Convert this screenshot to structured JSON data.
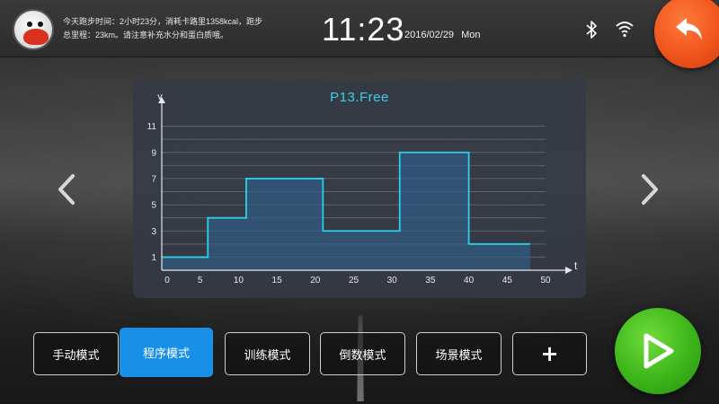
{
  "header": {
    "summary_line1": "今天跑步时间：2小时23分，消耗卡路里1358kcal，跑步",
    "summary_line2": "总里程：23km。请注意补充水分和蛋白质哦。",
    "time": "11:23",
    "date": "2016/02/29",
    "weekday": "Mon",
    "icons": [
      "bluetooth-icon",
      "wifi-icon",
      "back-arrow-icon"
    ]
  },
  "chart_title": "P13.Free",
  "chart_data": {
    "type": "area",
    "title": "P13.Free",
    "xlabel": "t",
    "ylabel": "v",
    "xlim": [
      0,
      50
    ],
    "ylim": [
      0,
      12
    ],
    "x_ticks": [
      0,
      5,
      10,
      15,
      20,
      25,
      30,
      35,
      40,
      45,
      50
    ],
    "y_ticks": [
      1,
      3,
      5,
      7,
      9,
      11
    ],
    "step": "post",
    "x": [
      0,
      6,
      11,
      21,
      31,
      40,
      48
    ],
    "y": [
      1,
      4,
      7,
      3,
      9,
      2,
      2
    ],
    "grid": true,
    "colors": {
      "line": "#2ad0e8",
      "fill": "#2f5f8a"
    }
  },
  "nav": {
    "prev_icon": "chevron-left-icon",
    "next_icon": "chevron-right-icon"
  },
  "modes": [
    {
      "label": "手动模式",
      "active": false
    },
    {
      "label": "程序模式",
      "active": true
    },
    {
      "label": "训练模式",
      "active": false
    },
    {
      "label": "倒数模式",
      "active": false
    },
    {
      "label": "场景模式",
      "active": false
    }
  ],
  "add_label": "+",
  "start_icon": "play-icon",
  "colors": {
    "accent": "#1890e8",
    "back": "#f0541c",
    "start": "#3cb51a",
    "title": "#3ad0e6"
  }
}
